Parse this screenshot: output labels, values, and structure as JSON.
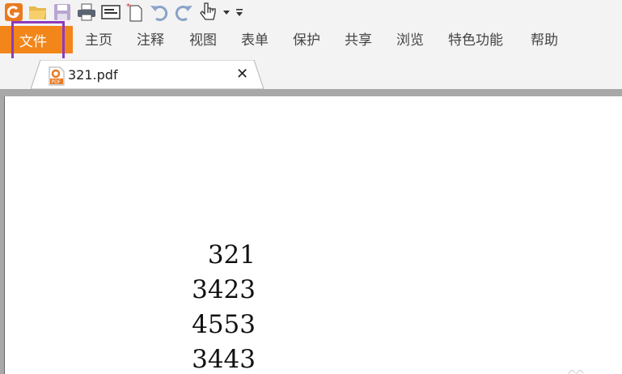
{
  "menu": {
    "file": "文件",
    "items": [
      "主页",
      "注释",
      "视图",
      "表单",
      "保护",
      "共享",
      "浏览",
      "特色功能",
      "帮助"
    ]
  },
  "tab": {
    "title": "321.pdf",
    "close_glyph": "✕"
  },
  "document": {
    "values": [
      "321",
      "3423",
      "4553",
      "3443"
    ]
  },
  "colors": {
    "file_tab": "#f2861b",
    "highlight": "#8e3bbd",
    "logo": "#ea7a1f"
  }
}
